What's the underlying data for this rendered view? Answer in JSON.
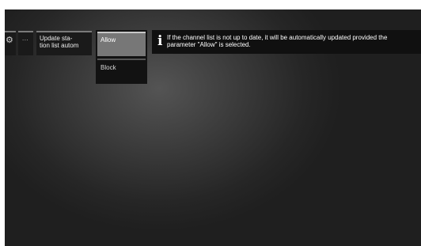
{
  "toolbar": {
    "gear_icon": "gear-icon",
    "ellipsis_label": "...",
    "update_label_line1": "Update sta-",
    "update_label_line2": "tion list autom"
  },
  "dropdown": {
    "options": [
      {
        "label": "Allow",
        "selected": true
      },
      {
        "label": "Block",
        "selected": false
      }
    ]
  },
  "info": {
    "icon": "info-icon",
    "text": "If the channel list is not up to date, it will be automatically updated provided the parameter \"Allow\" is selected."
  }
}
